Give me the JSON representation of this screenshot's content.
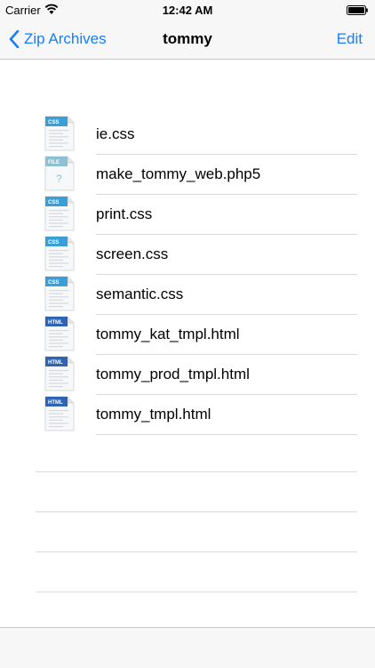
{
  "status_bar": {
    "carrier": "Carrier",
    "time": "12:42 AM"
  },
  "nav_bar": {
    "back_label": "Zip Archives",
    "title": "tommy",
    "edit_label": "Edit"
  },
  "colors": {
    "accent": "#157efb",
    "css_badge": "#3a9fd6",
    "html_badge": "#2f64b5",
    "file_badge": "#8fbfd2"
  },
  "files": [
    {
      "name": "ie.css",
      "type": "CSS",
      "icon": "css-file-icon"
    },
    {
      "name": "make_tommy_web.php5",
      "type": "FILE",
      "icon": "generic-file-icon"
    },
    {
      "name": "print.css",
      "type": "CSS",
      "icon": "css-file-icon"
    },
    {
      "name": "screen.css",
      "type": "CSS",
      "icon": "css-file-icon"
    },
    {
      "name": "semantic.css",
      "type": "CSS",
      "icon": "css-file-icon"
    },
    {
      "name": "tommy_kat_tmpl.html",
      "type": "HTML",
      "icon": "html-file-icon"
    },
    {
      "name": "tommy_prod_tmpl.html",
      "type": "HTML",
      "icon": "html-file-icon"
    },
    {
      "name": "tommy_tmpl.html",
      "type": "HTML",
      "icon": "html-file-icon"
    }
  ]
}
